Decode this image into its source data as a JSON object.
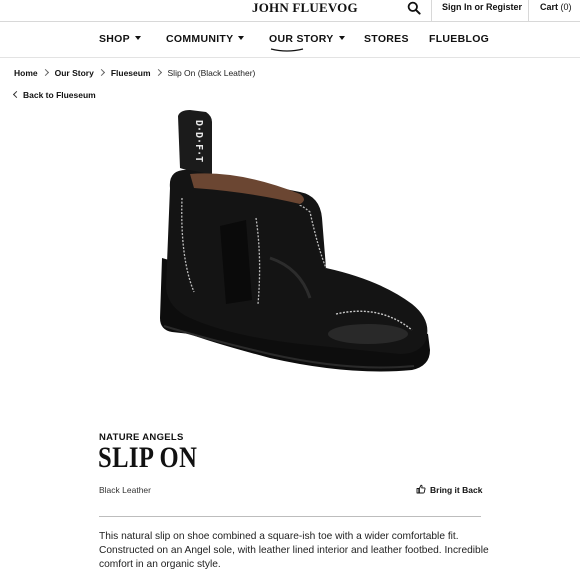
{
  "header": {
    "logo_main": "JOHN FLUEVOG",
    "sign_in_label": "Sign In or Register",
    "cart_label": "Cart",
    "cart_count": "(0)"
  },
  "nav": {
    "items": [
      {
        "label": "SHOP",
        "has_dropdown": true
      },
      {
        "label": "COMMUNITY",
        "has_dropdown": true
      },
      {
        "label": "OUR STORY",
        "has_dropdown": true,
        "active": true
      },
      {
        "label": "STORES",
        "has_dropdown": false
      },
      {
        "label": "FLUEBLOG",
        "has_dropdown": false
      }
    ]
  },
  "breadcrumb": {
    "items": [
      "Home",
      "Our Story",
      "Flueseum"
    ],
    "current": "Slip On (Black Leather)"
  },
  "back_link": "Back to Flueseum",
  "product": {
    "pull_tab_text": "D·D·F·T",
    "collection": "NATURE ANGELS",
    "name": "SLIP ON",
    "variant": "Black Leather",
    "bring_back_label": "Bring it Back",
    "description": "This natural slip on shoe combined a square-ish toe with a wider comfortable fit. Constructed on an Angel sole, with leather lined interior and leather footbed. Incredible comfort in an organic style."
  },
  "icons": {
    "search": "search-icon",
    "thumb": "thumbs-up-icon",
    "breadcrumb_sep": "chevron-right-icon",
    "back": "chevron-left-icon"
  },
  "colors": {
    "text": "#111111",
    "divider": "#d8d8d8",
    "shoe": "#141414"
  }
}
